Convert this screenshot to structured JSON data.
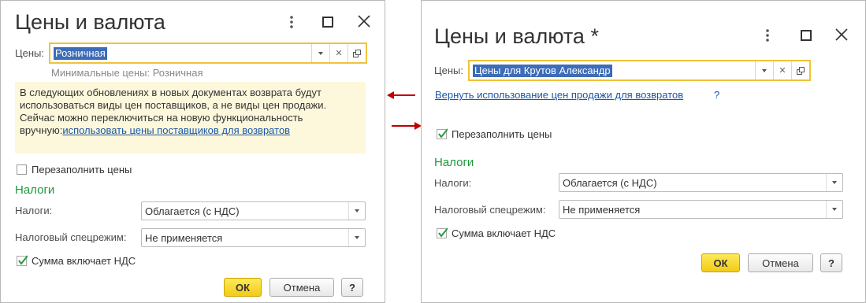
{
  "left": {
    "title": "Цены и валюта",
    "prices_label": "Цены:",
    "prices_value": "Розничная",
    "min_prices_hint": "Минимальные цены: Розничная",
    "notice_text": "В следующих обновлениях в новых документах возврата будут использоваться виды цен поставщиков, а не виды цен продажи. Сейчас можно переключиться на новую функциональность вручную:",
    "notice_link": "использовать цены поставщиков для возвратов",
    "refill_label": "Перезаполнить цены",
    "refill_checked": false,
    "taxes_section": "Налоги",
    "taxes_label": "Налоги:",
    "taxes_value": "Облагается (с НДС)",
    "regime_label": "Налоговый спецрежим:",
    "regime_value": "Не применяется",
    "vat_label": "Сумма включает НДС",
    "vat_checked": true,
    "ok_label": "ОК",
    "cancel_label": "Отмена",
    "help_label": "?"
  },
  "right": {
    "title": "Цены и валюта *",
    "prices_label": "Цены:",
    "prices_value": "Цены для Крутов Александр",
    "return_link": "Вернуть использование цен продажи для возвратов",
    "return_help": "?",
    "refill_label": "Перезаполнить цены",
    "refill_checked": true,
    "taxes_section": "Налоги",
    "taxes_label": "Налоги:",
    "taxes_value": "Облагается (с НДС)",
    "regime_label": "Налоговый спецрежим:",
    "regime_value": "Не применяется",
    "vat_label": "Сумма включает НДС",
    "vat_checked": true,
    "ok_label": "ОК",
    "cancel_label": "Отмена",
    "help_label": "?"
  },
  "icons": {
    "menu": "more-vertical-icon",
    "maximize": "maximize-icon",
    "close": "close-icon",
    "dropdown": "chevron-down-icon",
    "clear": "clear-icon",
    "open": "open-form-icon",
    "checkmark": "checkmark-icon",
    "annotation_arrow": "red-arrow-icon"
  },
  "colors": {
    "accent_field_border": "#f0c23a",
    "selection": "#3d6cb8",
    "section_green": "#1a9a3a",
    "link_blue": "#1a56a8",
    "notice_bg": "#fdf8dc",
    "ok_button": "#f3cb16",
    "annotation_arrow": "#c00000"
  }
}
